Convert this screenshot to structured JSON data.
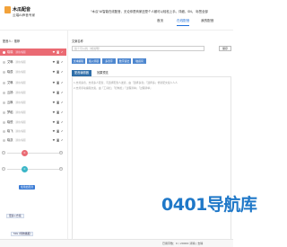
{
  "header": {
    "app_title": "木瓜配音",
    "app_subtitle": "云端AI声音专家",
    "notice": "\"木瓜\"AI智能在线配音，无论你是商家还是个人都可以轻松上手。详细，SN。 标签全部",
    "nav": [
      "首页",
      "在线配音",
      "我的配音"
    ],
    "nav_active_index": 1
  },
  "left": {
    "search_label": "配音人：推荐",
    "search_placeholder": "",
    "voices": [
      {
        "name": "晓晓",
        "license": "通用/客服",
        "acts": "♥ ◙ ✔"
      },
      {
        "name": "艾琳",
        "license": "通用/客服",
        "acts": "♥ ◙ ✔"
      },
      {
        "name": "晓辰",
        "license": "通用/客服",
        "acts": "♥ ◙ ✔"
      },
      {
        "name": "艾琳",
        "license": "通用/客服",
        "acts": "♥ ◙ ✔"
      },
      {
        "name": "云扬",
        "license": "通用/客服",
        "acts": "♥ ◙ ✔"
      },
      {
        "name": "云枫",
        "license": "通用/客服",
        "acts": "♥ ◙ ✔"
      },
      {
        "name": "梦稻",
        "license": "通用/客服",
        "acts": "♥ ◙ ✔"
      },
      {
        "name": "晓悦",
        "license": "通用/客服",
        "acts": "♥ ◙ ✔"
      },
      {
        "name": "晓飞",
        "license": "通用/客服",
        "acts": "♥ ◙ ✔"
      },
      {
        "name": "晓凯",
        "license": "通用/客服",
        "acts": "♥ ◙ ✔"
      }
    ],
    "speed_knob": "0",
    "pitch_knob": "0",
    "apply_button": "使用此配音",
    "tags": [
      {
        "label": "更多+方案"
      },
      {
        "label": "50x (特效播报)"
      }
    ]
  },
  "right": {
    "text_label": "文案名称",
    "text_placeholder": "给个可以找（或说明）",
    "save_button": "保存",
    "tools": [
      "文本编辑",
      "插入停顿",
      "多音字",
      "数字读法",
      "敏感词"
    ],
    "tabs": [
      "配音编辑器",
      "效果预览"
    ],
    "tab_active_index": 0,
    "hints": [
      "1.支持多音，支持多人配音，可选择配音人发音，由「选择多音」「选择多」修新配文案人人人",
      "2.支持手动编辑文案，由「工具栏」「控制栏」「过程清单」「过程清单」"
    ]
  },
  "footer": {
    "status": "已用字数：0 / 20000   清除 | 去除"
  },
  "watermark": {
    "text": "0401导航库",
    "url": ""
  },
  "colors": {
    "accent": "#ea6a73",
    "brand_blue": "#2f6ea8",
    "tool_blue": "#4e87cf",
    "watermark_blue": "#1f78c8",
    "watermark_red": "#e0413f"
  }
}
